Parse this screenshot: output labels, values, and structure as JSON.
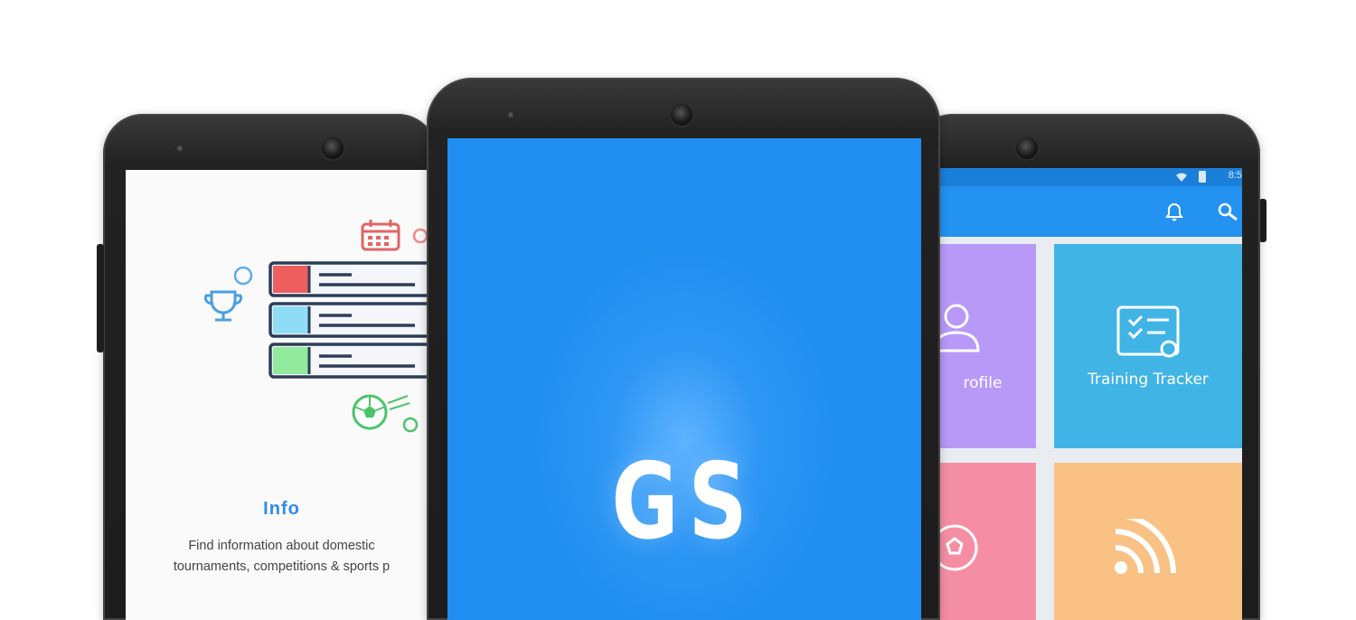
{
  "info_screen": {
    "title": "Info",
    "description_line1": "Find information about domestic",
    "description_line2": "tournaments, competitions & sports p"
  },
  "splash_screen": {
    "logo_text": "GS"
  },
  "dashboard_screen": {
    "status_time": "8:5",
    "tiles": [
      {
        "label": "rofile",
        "color": "#b899f8"
      },
      {
        "label": "Training Tracker",
        "color": "#41b4e6"
      },
      {
        "label": "",
        "color": "#f58ea4"
      },
      {
        "label": "",
        "color": "#f9c184"
      }
    ]
  },
  "colors": {
    "splash_blue": "#1f8ef0",
    "accent_blue": "#2f8be8",
    "app_bar": "#2392f1"
  }
}
